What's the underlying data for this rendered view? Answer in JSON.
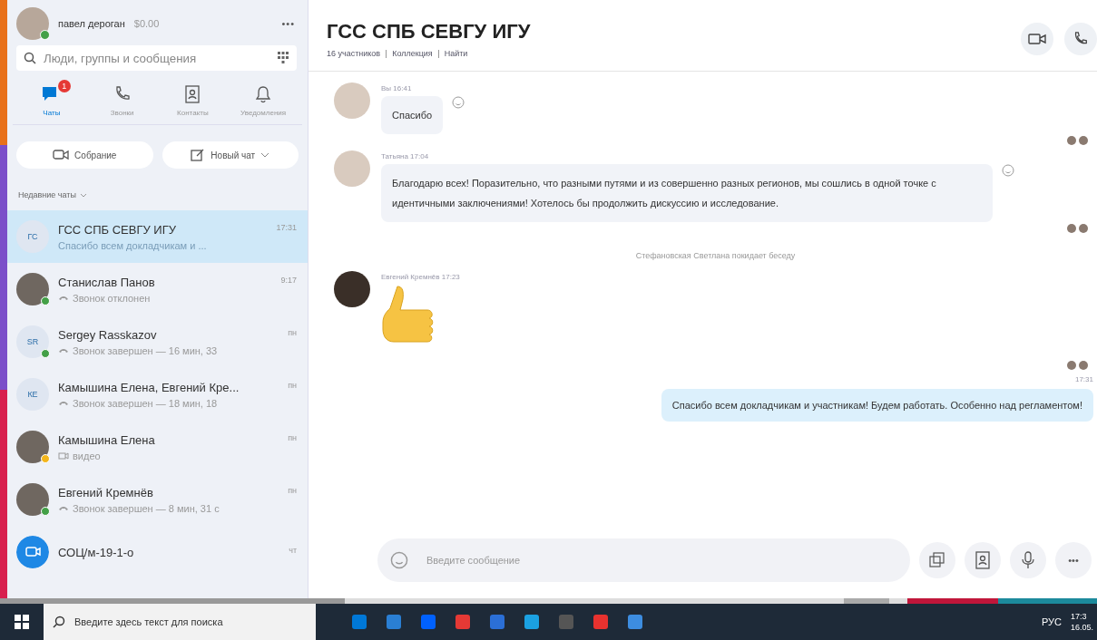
{
  "profile": {
    "name": "павел дероган",
    "balance": "$0.00",
    "more": "•••"
  },
  "search": {
    "placeholder": "Люди, группы и сообщения"
  },
  "nav_tabs": [
    {
      "kind": "chats",
      "label": "Чаты",
      "selected": true,
      "badge": "1"
    },
    {
      "kind": "calls",
      "label": "Звонки",
      "selected": false
    },
    {
      "kind": "contacts",
      "label": "Контакты",
      "selected": false
    },
    {
      "kind": "notifications",
      "label": "Уведомления",
      "selected": false
    }
  ],
  "actions": [
    {
      "kind": "meeting",
      "label": "Собрание"
    },
    {
      "kind": "new-chat",
      "label": "Новый чат"
    }
  ],
  "recent_label": "Недавние чаты",
  "chats": [
    {
      "kind": "initials",
      "initials": "ГС",
      "name": "ГСС СПБ СЕВГУ ИГУ",
      "time": "17:31",
      "preview": {
        "kind": "text",
        "text": "Спасибо всем докладчикам и ..."
      },
      "selected": true
    },
    {
      "kind": "photo",
      "color": "#43a047",
      "name": "Станислав Панов",
      "time": "9:17",
      "preview": {
        "kind": "call",
        "text": "Звонок отклонен"
      },
      "selected": false
    },
    {
      "kind": "initials",
      "initials": "SR",
      "color": "#43a047",
      "name": "Sergey Rasskazov",
      "time": "пн",
      "preview": {
        "kind": "call",
        "text": "Звонок завершен — 16 мин, 33"
      },
      "selected": false
    },
    {
      "kind": "initials",
      "initials": "КЕ",
      "name": "Камышина Елена, Евгений Кре...",
      "time": "пн",
      "preview": {
        "kind": "call",
        "text": "Звонок завершен — 18 мин, 18"
      },
      "selected": false
    },
    {
      "kind": "photo",
      "color": "#f3b51b",
      "name": "Камышина Елена",
      "time": "пн",
      "preview": {
        "kind": "video",
        "text": "видео"
      },
      "selected": false
    },
    {
      "kind": "photo",
      "color": "#43a047",
      "name": "Евгений Кремнёв",
      "time": "пн",
      "preview": {
        "kind": "call",
        "text": "Звонок завершен — 8 мин, 31 с"
      },
      "selected": false
    },
    {
      "kind": "group",
      "name": "СОЦ/м-19-1-о",
      "time": "чт",
      "selected": false
    }
  ],
  "conversation": {
    "title": "ГСС СПБ СЕВГУ ИГУ",
    "meta": [
      "16 участников",
      "Коллекция",
      "Найти"
    ],
    "messages": [
      {
        "kind": "incoming",
        "sender": "Вы 16:41",
        "text": "Спасибо"
      },
      {
        "kind": "incoming",
        "sender": "Татьяна 17:04",
        "text": "Благодарю всех! Поразительно, что разными путями и из совершенно  разных регионов, мы сошлись в одной точке с идентичными заключениями! Хотелось бы продолжить дискуссию и исследование."
      },
      {
        "kind": "system",
        "text": "Стефановская Светлана покидает беседу"
      },
      {
        "kind": "emoji",
        "sender": "Евгений Кремнёв 17:23"
      },
      {
        "kind": "outgoing",
        "time": "17:31",
        "text": "Спасибо всем докладчикам и участникам!  Будем работать. Особенно над регламентом!"
      }
    ],
    "composer": {
      "placeholder": "Введите сообщение",
      "more": "•••"
    }
  },
  "taskbar": {
    "search_placeholder": "Введите здесь текст для поиска",
    "language": "РУС",
    "time": "17:3",
    "date": "16.05."
  }
}
